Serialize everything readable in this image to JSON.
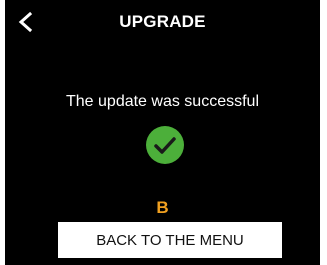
{
  "header": {
    "back_icon": "chevron-left-icon",
    "title": "UPGRADE"
  },
  "main": {
    "message": "The update was successful",
    "status_icon": "check-circle-icon",
    "status_color": "#4caf3a",
    "marker_label": "B",
    "marker_color": "#f0a020",
    "back_button_label": "BACK TO THE MENU"
  }
}
